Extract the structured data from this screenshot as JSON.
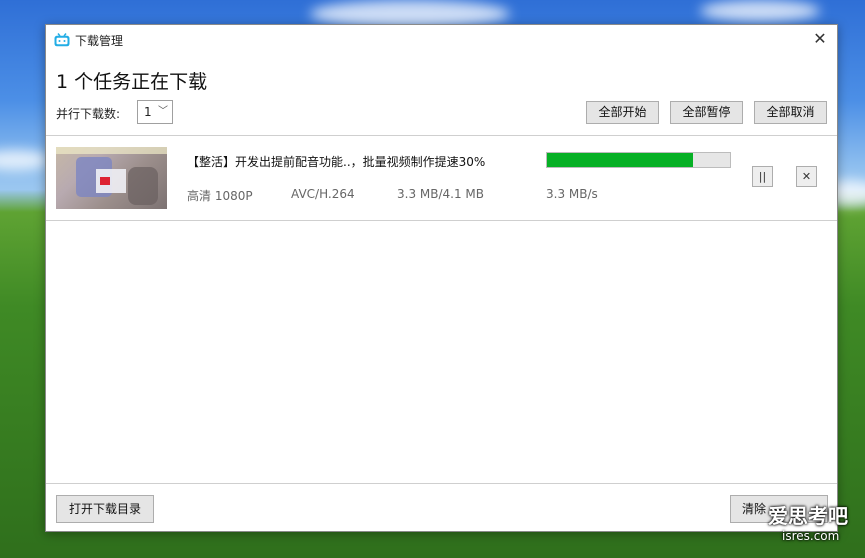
{
  "window": {
    "title": "下载管理",
    "close_glyph": "✕"
  },
  "header": {
    "heading": "1 个任务正在下载",
    "parallel_label": "并行下载数:",
    "parallel_value": "1"
  },
  "toolbar": {
    "start_all": "全部开始",
    "pause_all": "全部暂停",
    "cancel_all": "全部取消"
  },
  "tasks": [
    {
      "title": "【整活】开发出提前配音功能..，批量视频制作提速30%",
      "quality": "高清 1080P",
      "codec": "AVC/H.264",
      "size": "3.3 MB/4.1 MB",
      "speed": "3.3 MB/s",
      "progress_fraction": 0.8,
      "pause_glyph": "||",
      "cancel_glyph": "✕"
    }
  ],
  "footer": {
    "open_dir": "打开下载目录",
    "clear_label": "清除"
  },
  "watermark": {
    "line1": "爱思考吧",
    "line2": "isres.com"
  },
  "colors": {
    "progress": "#06b025",
    "app_icon": "#23ade5"
  }
}
